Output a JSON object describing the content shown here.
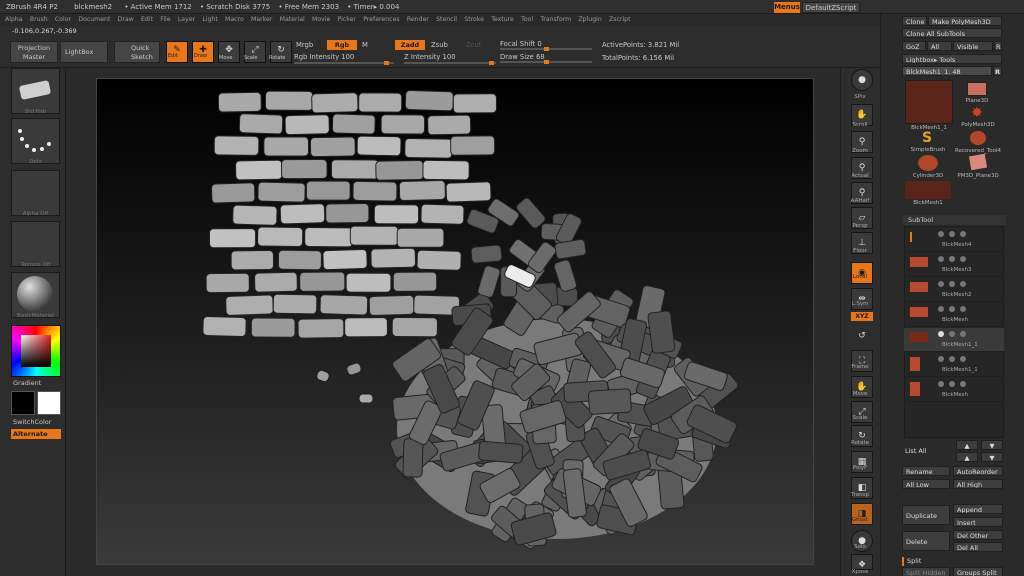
{
  "titlebar": {
    "app": "ZBrush 4R4 P2",
    "doc": "blckmesh2",
    "active_mem": "• Active Mem 1712",
    "scratch": "• Scratch Disk 3775",
    "free_mem": "• Free Mem 2303",
    "timer": "• Timer▸ 0.004",
    "menus_btn": "Menus",
    "script_btn": "DefaultZScript"
  },
  "coords": "-0.106,0.267,-0.369",
  "menus": [
    "Alpha",
    "Brush",
    "Color",
    "Document",
    "Draw",
    "Edit",
    "File",
    "Layer",
    "Light",
    "Macro",
    "Marker",
    "Material",
    "Movie",
    "Picker",
    "Preferences",
    "Render",
    "Stencil",
    "Stroke",
    "Texture",
    "Tool",
    "Transform",
    "Zplugin",
    "Zscript"
  ],
  "shelf": {
    "projection": "Projection Master",
    "lightbox": "LightBox",
    "quicksketch": "Quick Sketch",
    "edit": "Edit",
    "draw": "Draw",
    "move": "Move",
    "scale": "Scale",
    "rotate": "Rotate",
    "mrgb": "Mrgb",
    "rgb": "Rgb",
    "m": "M",
    "rgb_intensity": "Rgb Intensity 100",
    "zadd": "Zadd",
    "zsub": "Zsub",
    "zcut": "Zcut",
    "z_intensity": "Z Intensity 100",
    "focal_shift": "Focal Shift 0",
    "draw_size": "Draw Size 68",
    "active_points": "ActivePoints: 3.821 Mil",
    "total_points": "TotalPoints: 6.156 Mil"
  },
  "leftshelf": {
    "brush_cap": "Std Hsb",
    "stroke_cap": "Dots",
    "alpha_cap": "Alpha Off",
    "texture_cap": "Texture Off",
    "material_cap": "BasicMaterial",
    "gradient": "Gradient",
    "switchcolor": "SwitchColor",
    "alternate": "Alternate"
  },
  "rshelf": [
    "SPix",
    "Scroll",
    "Zoom",
    "Actual",
    "AAHalf",
    "Persp",
    "Floor",
    "Local",
    "L.Sym",
    "XYZ",
    "",
    "Frame",
    "Move",
    "Scale",
    "Rotate",
    "PolyF",
    "Transp",
    "Ghost",
    "Solo",
    "Xpose"
  ],
  "tool": {
    "clone": "Clone",
    "make_poly": "Make PolyMesh3D",
    "clone_all": "Clone All SubTools",
    "goz": "GoZ",
    "all": "All",
    "visible": "Visible",
    "r": "R",
    "lightbox_tools": "Lightbox▸ Tools",
    "current": "BlckMesh1_1. 48",
    "r2": "R",
    "thumbs": [
      "BlckMesh1_1",
      "Plane3D",
      "SimpleBrush",
      "PolyMesh3D",
      "Cylinder3D",
      "Recovered_Tool4",
      "BlckMesh1",
      "PM3D_Plane3D"
    ]
  },
  "subtool": {
    "header": "SubTool",
    "items": [
      "BlckMesh4",
      "BlckMesh3",
      "BlckMesh2",
      "BlckMesh",
      "BlckMesh1_1",
      "BlckMesh1_1",
      "BlckMesh"
    ],
    "list_all": "List All",
    "rename": "Rename",
    "autoreorder": "AutoReorder",
    "all_low": "All Low",
    "all_high": "All High",
    "duplicate": "Duplicate",
    "append": "Append",
    "insert": "Insert",
    "delete": "Delete",
    "del_other": "Del Other",
    "del_all": "Del All",
    "split": "Split",
    "split_hidden": "Split Hidden",
    "groups_split": "Groups Split"
  }
}
